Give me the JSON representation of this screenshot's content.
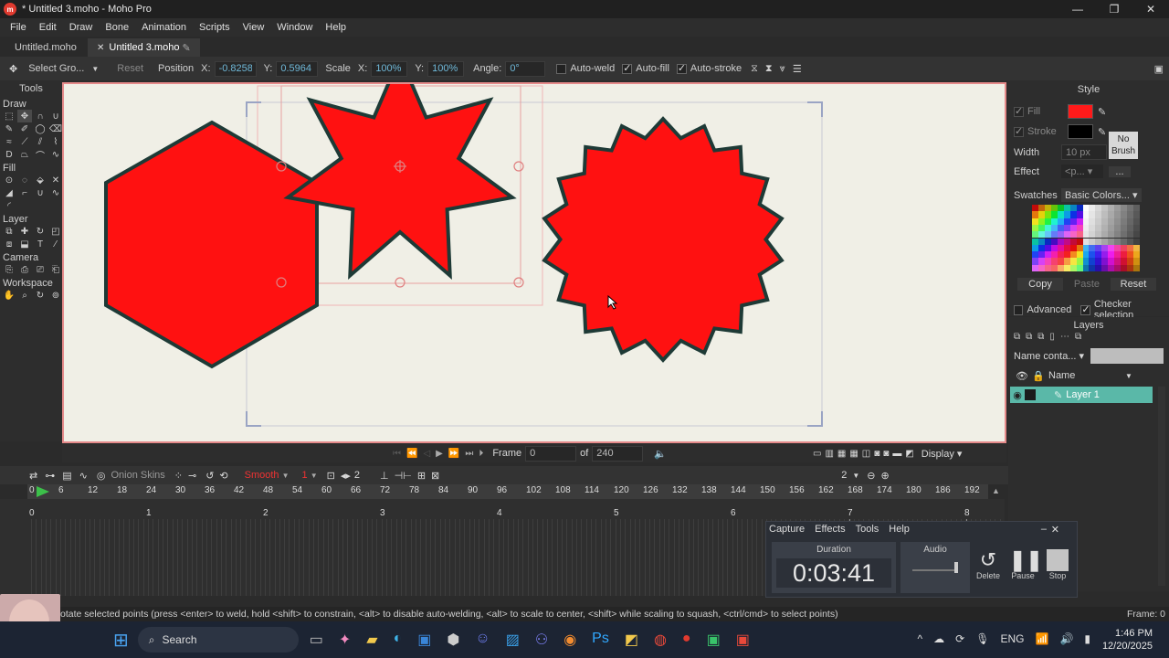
{
  "window": {
    "title": "* Untitled 3.moho - Moho Pro",
    "app_badge": "m"
  },
  "menu": [
    "File",
    "Edit",
    "Draw",
    "Bone",
    "Animation",
    "Scripts",
    "View",
    "Window",
    "Help"
  ],
  "doc_tabs": [
    {
      "label": "Untitled.moho"
    },
    {
      "label": "Untitled 3.moho"
    }
  ],
  "tool_options": {
    "select_group": "Select Gro...",
    "reset": "Reset",
    "position_label": "Position",
    "x_label": "X:",
    "x_value": "-0.8258",
    "y_label": "Y:",
    "y_value": "0.5964",
    "scale_label": "Scale",
    "scale_x_label": "X:",
    "scale_x": "100%",
    "scale_y_label": "Y:",
    "scale_y": "100%",
    "angle_label": "Angle:",
    "angle_value": "0°",
    "auto_weld": "Auto-weld",
    "auto_fill": "Auto-fill",
    "auto_stroke": "Auto-stroke"
  },
  "tools_panel": {
    "title": "Tools",
    "sections": [
      "Draw",
      "Fill",
      "Layer",
      "Camera",
      "Workspace"
    ]
  },
  "style_panel": {
    "title": "Style",
    "fill_label": "Fill",
    "stroke_label": "Stroke",
    "width_label": "Width",
    "width_value": "10 px",
    "no_brush": "No Brush",
    "effect_label": "Effect",
    "effect_value": "<p...",
    "effect_more": "...",
    "swatches_label": "Swatches",
    "swatches_value": "Basic Colors...",
    "copy": "Copy",
    "paste": "Paste",
    "reset": "Reset",
    "advanced": "Advanced",
    "checker_selection": "Checker selection",
    "fill_color": "#ff1a1a",
    "stroke_color": "#000000"
  },
  "layers_panel": {
    "title": "Layers",
    "filter_value": "Name conta...",
    "name_header": "Name",
    "layers": [
      {
        "name": "Layer 1"
      }
    ]
  },
  "playback": {
    "frame_label": "Frame",
    "frame_value": "0",
    "of_label": "of",
    "of_value": "240",
    "display": "Display"
  },
  "timeline": {
    "onion_skins": "Onion Skins",
    "smooth": "Smooth",
    "smooth_value": "1",
    "onion_count": "2",
    "zoom_value": "2",
    "ruler_ticks": [
      "0",
      "6",
      "12",
      "18",
      "24",
      "30",
      "36",
      "42",
      "48",
      "54",
      "60",
      "66",
      "72",
      "78",
      "84",
      "90",
      "96",
      "102",
      "108",
      "114",
      "120",
      "126",
      "132",
      "138",
      "144",
      "150",
      "156",
      "162",
      "168",
      "174",
      "180",
      "186",
      "192"
    ],
    "second_marks": [
      "0",
      "1",
      "2",
      "3",
      "4",
      "5",
      "6",
      "7",
      "8"
    ]
  },
  "recorder": {
    "menu": [
      "Capture",
      "Effects",
      "Tools",
      "Help"
    ],
    "duration_label": "Duration",
    "duration_value": "0:03:41",
    "audio_label": "Audio",
    "delete": "Delete",
    "pause": "Pause",
    "stop": "Stop"
  },
  "status": {
    "hint": "otate selected points (press <enter> to weld, hold <shift> to constrain, <alt> to disable auto-welding, <alt> to scale to center, <shift> while scaling to squash, <ctrl/cmd> to select points)",
    "frame": "Frame: 0"
  },
  "taskbar": {
    "search": "Search",
    "language": "ENG",
    "time": "1:46 PM",
    "date": "12/20/2025"
  }
}
